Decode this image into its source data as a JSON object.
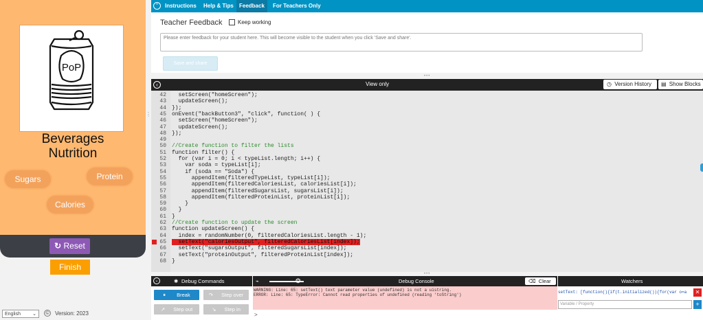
{
  "app": {
    "title_line1": "Beverages",
    "title_line2": "Nutrition",
    "can_label": "PoP",
    "buttons": {
      "sugars": "Sugars",
      "protein": "Protein",
      "calories": "Calories"
    },
    "reset_label": "Reset",
    "finish_label": "Finish"
  },
  "footer": {
    "language": "English",
    "version": "Version: 2023"
  },
  "topnav": {
    "tabs": [
      "Instructions",
      "Help & Tips",
      "Feedback",
      "For Teachers Only"
    ],
    "active": "Feedback"
  },
  "feedback": {
    "title": "Teacher Feedback",
    "keep_working": "Keep working",
    "placeholder": "Please enter feedback for your student here. This will become visible to the student when you click 'Save and share'.",
    "save_label": "Save and share"
  },
  "editor": {
    "header": "View only",
    "version_history": "Version History",
    "show_blocks": "Show Blocks",
    "lines": [
      {
        "n": "42",
        "t": "  setScreen(\"homeScreen\");"
      },
      {
        "n": "43",
        "t": "  updateScreen();"
      },
      {
        "n": "44",
        "t": "});"
      },
      {
        "n": "45",
        "t": "onEvent(\"backButton3\", \"click\", function( ) {"
      },
      {
        "n": "46",
        "t": "  setScreen(\"homeScreen\");"
      },
      {
        "n": "47",
        "t": "  updateScreen();"
      },
      {
        "n": "48",
        "t": "});"
      },
      {
        "n": "49",
        "t": ""
      },
      {
        "n": "50",
        "t": "//Create function to filter the lists"
      },
      {
        "n": "51",
        "t": "function filter() {"
      },
      {
        "n": "52",
        "t": "  for (var i = 0; i < typeList.length; i++) {"
      },
      {
        "n": "53",
        "t": "    var soda = typeList[i];"
      },
      {
        "n": "54",
        "t": "    if (soda == \"Soda\") {"
      },
      {
        "n": "55",
        "t": "      appendItem(filteredTypeList, typeList[i]);"
      },
      {
        "n": "56",
        "t": "      appendItem(filteredCaloriesList, caloriesList[i]);"
      },
      {
        "n": "57",
        "t": "      appendItem(filteredSugarsList, sugarsList[i]);"
      },
      {
        "n": "58",
        "t": "      appendItem(filteredProteinList, proteinList[i]);"
      },
      {
        "n": "59",
        "t": "    }"
      },
      {
        "n": "60",
        "t": "  }"
      },
      {
        "n": "61",
        "t": "}"
      },
      {
        "n": "62",
        "t": "//Create function to update the screen"
      },
      {
        "n": "63",
        "t": "function updateScreen() {"
      },
      {
        "n": "64",
        "t": "  index = randomNumber(0, filteredCaloriesList.length - 1);"
      },
      {
        "n": "65",
        "t": "  setText(\"caloriesOutput\", filteredCaloriesList[index]);"
      },
      {
        "n": "66",
        "t": "  setText(\"sugarsOutput\", filteredSugarsList[index]);"
      },
      {
        "n": "67",
        "t": "  setText(\"proteinOutput\", filteredProteinList[index]);"
      },
      {
        "n": "68",
        "t": "}"
      }
    ],
    "error_line": "65"
  },
  "debug": {
    "commands_title": "Debug Commands",
    "break_label": "Break",
    "step_over_label": "Step over",
    "step_out_label": "Step out",
    "step_in_label": "Step in",
    "console_title": "Debug Console",
    "clear_label": "Clear",
    "console_line1": "WARNING: Line: 65: setText() text parameter value (undefined) is not a uistring.",
    "console_line2": "ERROR: Line: 65: TypeError: Cannot read properties of undefined (reading 'toString')",
    "prompt": ">",
    "watchers_title": "Watchers",
    "watch_entry": "setText: [function(){if(t.initialized()){for(var o=a",
    "watch_placeholder": "Variable / Property"
  },
  "colors": {
    "nav": "#0093c4",
    "app_bg": "#ffb870",
    "reset": "#8d59b5",
    "finish": "#fb9e00",
    "break": "#1e88c8",
    "error": "#e02020"
  }
}
